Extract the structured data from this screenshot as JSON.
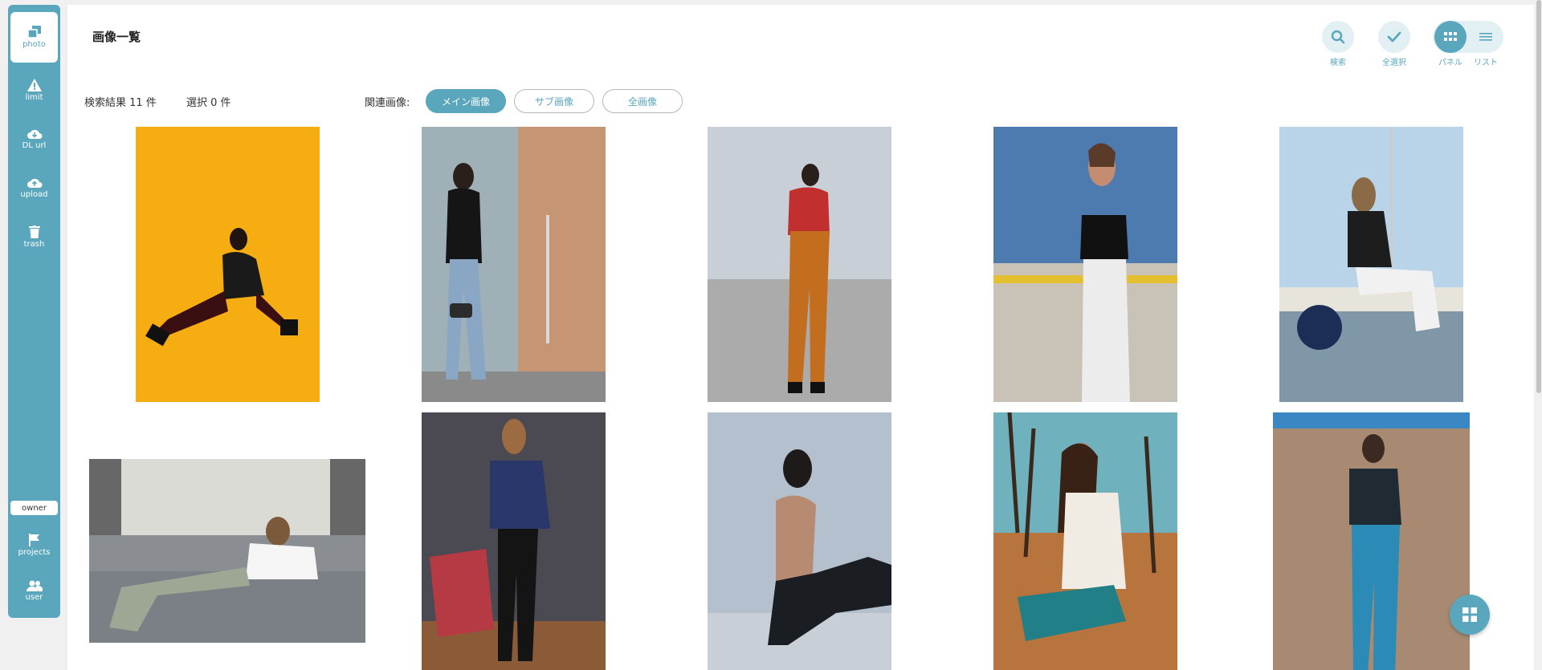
{
  "sidebar": {
    "items": [
      {
        "label": "photo",
        "icon": "photo-icon"
      },
      {
        "label": "limit",
        "icon": "warning-icon"
      },
      {
        "label": "DL url",
        "icon": "cloud-download-icon"
      },
      {
        "label": "upload",
        "icon": "cloud-upload-icon"
      },
      {
        "label": "trash",
        "icon": "trash-icon"
      }
    ],
    "owner_badge": "owner",
    "bottom_items": [
      {
        "label": "projects",
        "icon": "flag-icon"
      },
      {
        "label": "user",
        "icon": "users-icon"
      }
    ]
  },
  "header": {
    "title": "画像一覧",
    "tools": {
      "search": "検索",
      "select_all": "全選択",
      "panel": "パネル",
      "list": "リスト"
    }
  },
  "filter": {
    "result_text": "検索結果 11 件",
    "selected_text": "選択 0 件",
    "related_label": "関連画像:",
    "buttons": [
      "メイン画像",
      "サブ画像",
      "全画像"
    ],
    "active_button": "メイン画像"
  },
  "photos": [
    {
      "alt": "woman sitting on yellow backdrop"
    },
    {
      "alt": "woman in leather jacket by wooden door"
    },
    {
      "alt": "woman in red sweater and orange trousers"
    },
    {
      "alt": "woman in black crop top outdoors"
    },
    {
      "alt": "woman sitting on boat"
    },
    {
      "alt": "woman lying on grey sofa"
    },
    {
      "alt": "woman in blue blouse against grey wall"
    },
    {
      "alt": "woman sitting on floor, side profile"
    },
    {
      "alt": "woman in white sweater among trees"
    },
    {
      "alt": "woman in graphic tee against wooden wall"
    }
  ],
  "colors": {
    "accent": "#5aa7bd",
    "accent_light": "#e2f0f4"
  }
}
